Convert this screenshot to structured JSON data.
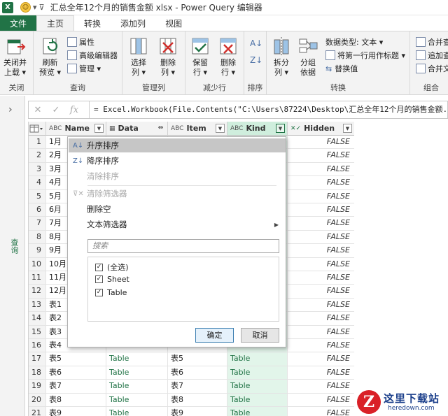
{
  "titlebar": {
    "app_icon": "X",
    "title": "汇总全年12个月的销售金额 xlsx - Power Query 编辑器"
  },
  "tabs": [
    "文件",
    "主页",
    "转换",
    "添加列",
    "视图"
  ],
  "ribbon": {
    "close_group": {
      "label": "关闭",
      "btn1": "关闭并",
      "btn2": "上载 ▾"
    },
    "query_group": {
      "label": "查询",
      "refresh1": "刷新",
      "refresh2": "预览 ▾",
      "props": "属性",
      "adv": "高级编辑器",
      "manage": "管理 ▾"
    },
    "manage_cols": {
      "label": "管理列",
      "choose1": "选择",
      "choose2": "列 ▾",
      "remove1": "删除",
      "remove2": "列 ▾"
    },
    "reduce_rows": {
      "label": "减少行",
      "keep1": "保留",
      "keep2": "行 ▾",
      "delrow1": "删除",
      "delrow2": "行 ▾"
    },
    "sort": {
      "label": "排序"
    },
    "transform": {
      "label": "转换",
      "split1": "拆分",
      "split2": "列 ▾",
      "group1": "分组",
      "group2": "依据",
      "dtype": "数据类型: 文本 ▾",
      "firstrow": "将第一行用作标题 ▾",
      "replace": "替换值"
    },
    "combine": {
      "label": "组合",
      "merge": "合并查",
      "append": "追加查",
      "files": "合并文"
    }
  },
  "leftpane": {
    "label": "查询"
  },
  "formula": {
    "text": "= Excel.Workbook(File.Contents(\"C:\\Users\\87224\\Desktop\\汇总全年12个月的销售金额.xl"
  },
  "columns": [
    {
      "type": "ABC",
      "name": "Name"
    },
    {
      "type": "",
      "name": "Data"
    },
    {
      "type": "ABC",
      "name": "Item"
    },
    {
      "type": "ABC",
      "name": "Kind"
    },
    {
      "type": "",
      "name": "Hidden"
    }
  ],
  "rows": [
    {
      "n": "1",
      "name": "1月",
      "data": "",
      "item": "",
      "kind": "",
      "hidden": "FALSE"
    },
    {
      "n": "2",
      "name": "2月",
      "data": "",
      "item": "",
      "kind": "",
      "hidden": "FALSE"
    },
    {
      "n": "3",
      "name": "3月",
      "data": "",
      "item": "",
      "kind": "",
      "hidden": "FALSE"
    },
    {
      "n": "4",
      "name": "4月",
      "data": "",
      "item": "",
      "kind": "",
      "hidden": "FALSE"
    },
    {
      "n": "5",
      "name": "5月",
      "data": "",
      "item": "",
      "kind": "",
      "hidden": "FALSE"
    },
    {
      "n": "6",
      "name": "6月",
      "data": "",
      "item": "",
      "kind": "",
      "hidden": "FALSE"
    },
    {
      "n": "7",
      "name": "7月",
      "data": "",
      "item": "",
      "kind": "",
      "hidden": "FALSE"
    },
    {
      "n": "8",
      "name": "8月",
      "data": "",
      "item": "",
      "kind": "",
      "hidden": "FALSE"
    },
    {
      "n": "9",
      "name": "9月",
      "data": "",
      "item": "",
      "kind": "",
      "hidden": "FALSE"
    },
    {
      "n": "10",
      "name": "10月",
      "data": "",
      "item": "",
      "kind": "",
      "hidden": "FALSE"
    },
    {
      "n": "11",
      "name": "11月",
      "data": "",
      "item": "",
      "kind": "",
      "hidden": "FALSE"
    },
    {
      "n": "12",
      "name": "12月",
      "data": "",
      "item": "",
      "kind": "",
      "hidden": "FALSE"
    },
    {
      "n": "13",
      "name": "表1",
      "data": "",
      "item": "",
      "kind": "",
      "hidden": "FALSE"
    },
    {
      "n": "14",
      "name": "表2",
      "data": "",
      "item": "",
      "kind": "",
      "hidden": "FALSE"
    },
    {
      "n": "15",
      "name": "表3",
      "data": "",
      "item": "",
      "kind": "",
      "hidden": "FALSE"
    },
    {
      "n": "16",
      "name": "表4",
      "data": "",
      "item": "",
      "kind": "",
      "hidden": "FALSE"
    },
    {
      "n": "17",
      "name": "表5",
      "data": "Table",
      "item": "表5",
      "kind": "Table",
      "hidden": "FALSE"
    },
    {
      "n": "18",
      "name": "表6",
      "data": "Table",
      "item": "表6",
      "kind": "Table",
      "hidden": "FALSE"
    },
    {
      "n": "19",
      "name": "表7",
      "data": "Table",
      "item": "表7",
      "kind": "Table",
      "hidden": "FALSE"
    },
    {
      "n": "20",
      "name": "表8",
      "data": "Table",
      "item": "表8",
      "kind": "Table",
      "hidden": "FALSE"
    },
    {
      "n": "21",
      "name": "表9",
      "data": "Table",
      "item": "表9",
      "kind": "Table",
      "hidden": "FALSE"
    }
  ],
  "menu": {
    "sort_asc": "升序排序",
    "sort_desc": "降序排序",
    "clear_sort": "清除排序",
    "clear_filter": "清除筛选器",
    "remove_empty": "删除空",
    "text_filters": "文本筛选器",
    "search_placeholder": "搜索",
    "options": [
      "(全选)",
      "Sheet",
      "Table"
    ],
    "ok": "确定",
    "cancel": "取消"
  },
  "watermark": {
    "logo": "Z",
    "text": "这里下载站",
    "url": "heredown.com"
  }
}
